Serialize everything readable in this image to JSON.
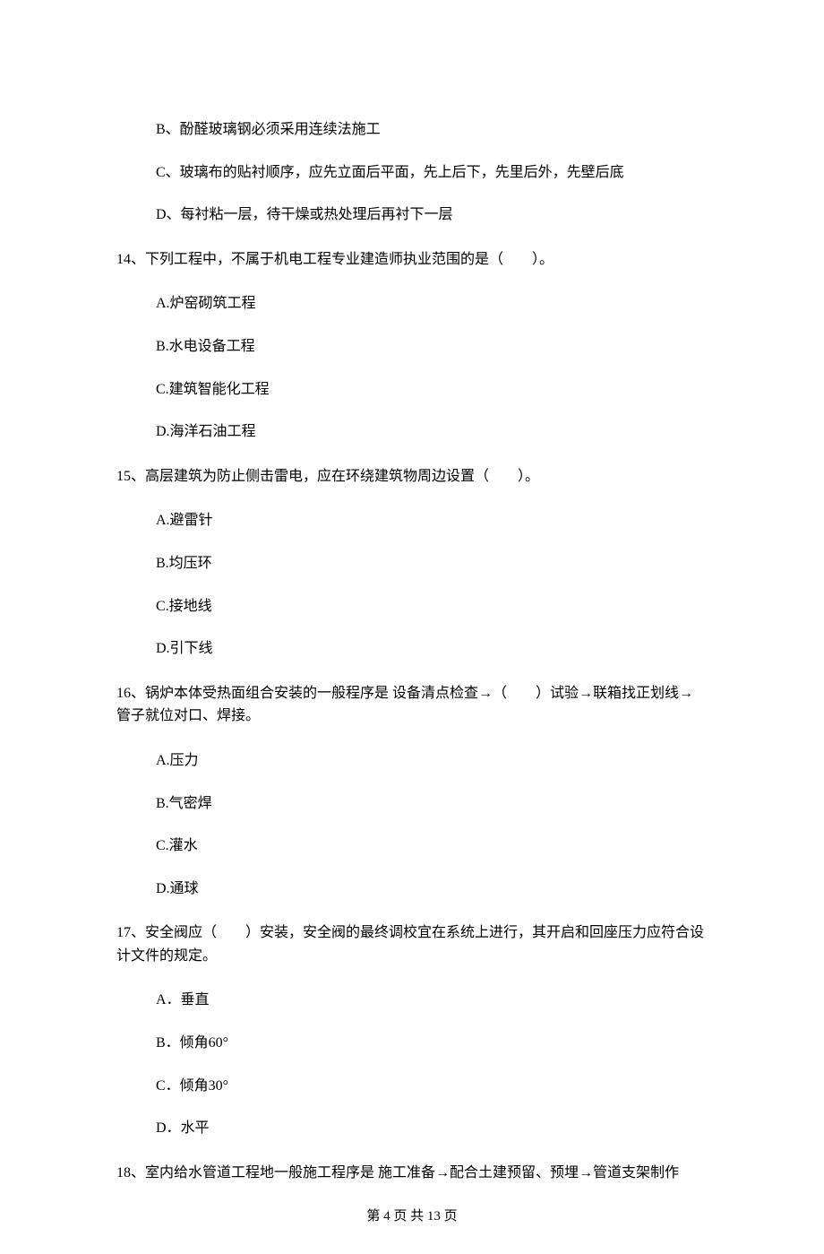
{
  "orphanOptions": [
    "B、酚醛玻璃钢必须采用连续法施工",
    "C、玻璃布的贴衬顺序，应先立面后平面，先上后下，先里后外，先壁后底",
    "D、每衬粘一层，待干燥或热处理后再衬下一层"
  ],
  "questions": [
    {
      "num": "14、",
      "text": "下列工程中，不属于机电工程专业建造师执业范围的是（　　）。",
      "options": [
        "A.炉窑砌筑工程",
        "B.水电设备工程",
        "C.建筑智能化工程",
        "D.海洋石油工程"
      ]
    },
    {
      "num": "15、",
      "text": "高层建筑为防止侧击雷电，应在环绕建筑物周边设置（　　）。",
      "options": [
        "A.避雷针",
        "B.均压环",
        "C.接地线",
        "D.引下线"
      ]
    },
    {
      "num": "16、",
      "text": "锅炉本体受热面组合安装的一般程序是 设备清点检查→（　　）试验→联箱找正划线→管子就位对口、焊接。",
      "options": [
        "A.压力",
        "B.气密焊",
        "C.灌水",
        "D.通球"
      ]
    },
    {
      "num": "17、",
      "text": "安全阀应（　　）安装，安全阀的最终调校宜在系统上进行，其开启和回座压力应符合设计文件的规定。",
      "options": [
        "A．垂直",
        "B．倾角60°",
        "C．倾角30°",
        "D．水平"
      ]
    },
    {
      "num": "18、",
      "text": "室内给水管道工程地一般施工程序是 施工准备→配合土建预留、预埋→管道支架制作",
      "options": []
    }
  ],
  "footer": "第 4 页 共 13 页"
}
